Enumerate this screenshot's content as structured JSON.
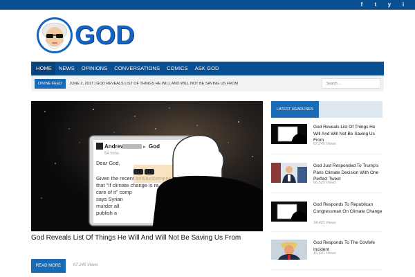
{
  "social": [
    "f",
    "t",
    "y",
    "i"
  ],
  "social_names": [
    "facebook-icon",
    "twitter-icon",
    "youtube-icon",
    "instagram-icon"
  ],
  "site": {
    "logo_text": "GOD"
  },
  "nav": [
    "HOME",
    "NEWS",
    "OPINIONS",
    "CONVERSATIONS",
    "COMICS",
    "ASK GOD"
  ],
  "ticker": {
    "tag": "DIVINE FEED",
    "text": "JUNE 2, 2017  |  GOD REVEALS LIST OF THINGS HE WILL AND WILL NOT BE SAVING US FROM",
    "search_placeholder": "Search ..."
  },
  "hero": {
    "letter_name": "Andrew",
    "letter_to": "God",
    "letter_time": "54 mins",
    "letter_lines": [
      "Dear God,",
      "",
      "Given the recent announcement",
      "that \"If climate change is re",
      "care of it\" comp",
      "says Syrian",
      "murder all",
      "publish a"
    ],
    "headline": "God Reveals List Of Things He Will And Will Not Be Saving Us From",
    "read_more": "READ MORE",
    "views": "67,245 Views"
  },
  "sidebar": {
    "header": "LATEST HEADLINES",
    "items": [
      {
        "title": "God Reveals List Of Things He Will And Will Not Be Saving Us From",
        "views": "67,245 Views"
      },
      {
        "title": "God Just Responded To Trump's Paris Climate Decision With One Perfect Tweet",
        "views": "66,525 Views"
      },
      {
        "title": "God Responds To Republican Congressman On Climate Change",
        "views": "34,421 Views"
      },
      {
        "title": "God Responds To The Covfefe Incident",
        "views": "15,641 Views"
      }
    ]
  },
  "colors": {
    "brand_blue": "#0b4f93",
    "accent_blue": "#1a6bb5",
    "logo_blue": "#1565c0"
  }
}
